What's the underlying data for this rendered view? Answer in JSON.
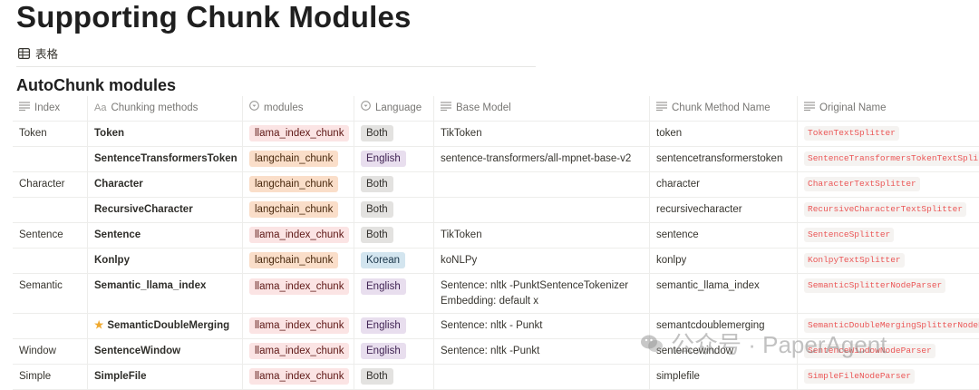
{
  "page": {
    "title": "Supporting Chunk Modules"
  },
  "view": {
    "tab_label": "表格"
  },
  "section": {
    "title": "AutoChunk modules"
  },
  "columns": [
    {
      "label": "Index",
      "icon": "text-lines-icon"
    },
    {
      "label": "Chunking methods",
      "icon": "title-aa-icon"
    },
    {
      "label": "modules",
      "icon": "select-icon"
    },
    {
      "label": "Language",
      "icon": "select-icon"
    },
    {
      "label": "Base Model",
      "icon": "text-lines-icon"
    },
    {
      "label": "Chunk Method Name",
      "icon": "text-lines-icon"
    },
    {
      "label": "Original Name",
      "icon": "text-lines-icon"
    }
  ],
  "rows": [
    {
      "index": "Token",
      "method": "Token",
      "module": "llama_index_chunk",
      "language": "Both",
      "base_model": "TikToken",
      "base_model_2": "",
      "chunk_method": "token",
      "original": "TokenTextSplitter"
    },
    {
      "index": "",
      "method": "SentenceTransformersToken",
      "module": "langchain_chunk",
      "language": "English",
      "base_model": "sentence-transformers/all-mpnet-base-v2",
      "base_model_2": "",
      "chunk_method": "sentencetransformerstoken",
      "original": "SentenceTransformersTokenTextSplitt"
    },
    {
      "index": "Character",
      "method": "Character",
      "module": "langchain_chunk",
      "language": "Both",
      "base_model": "",
      "base_model_2": "",
      "chunk_method": "character",
      "original": "CharacterTextSplitter"
    },
    {
      "index": "",
      "method": "RecursiveCharacter",
      "module": "langchain_chunk",
      "language": "Both",
      "base_model": "",
      "base_model_2": "",
      "chunk_method": "recursivecharacter",
      "original": "RecursiveCharacterTextSplitter"
    },
    {
      "index": "Sentence",
      "method": "Sentence",
      "module": "llama_index_chunk",
      "language": "Both",
      "base_model": "TikToken",
      "base_model_2": "",
      "chunk_method": "sentence",
      "original": "SentenceSplitter"
    },
    {
      "index": "",
      "method": "Konlpy",
      "module": "langchain_chunk",
      "language": "Korean",
      "base_model": "koNLPy",
      "base_model_2": "",
      "chunk_method": "konlpy",
      "original": "KonlpyTextSplitter"
    },
    {
      "index": "Semantic",
      "method": "Semantic_llama_index",
      "module": "llama_index_chunk",
      "language": "English",
      "base_model": "Sentence: nltk -PunktSentenceTokenizer",
      "base_model_2": "Embedding: default x",
      "chunk_method": "semantic_llama_index",
      "original": "SemanticSplitterNodeParser"
    },
    {
      "index": "",
      "method": "SemanticDoubleMerging",
      "module": "llama_index_chunk",
      "language": "English",
      "base_model": "Sentence: nltk - Punkt",
      "base_model_2": "",
      "chunk_method": "semantcdoublemerging",
      "original": "SemanticDoubleMergingSplitterNodePa"
    },
    {
      "index": "Window",
      "method": "SentenceWindow",
      "module": "llama_index_chunk",
      "language": "English",
      "base_model": "Sentence: nltk -Punkt",
      "base_model_2": "",
      "chunk_method": "sentencewindow",
      "original": "SentenceWindowNodeParser"
    },
    {
      "index": "Simple",
      "method": "SimpleFile",
      "module": "llama_index_chunk",
      "language": "Both",
      "base_model": "",
      "base_model_2": "",
      "chunk_method": "simplefile",
      "original": "SimpleFileNodeParser"
    }
  ],
  "watermark": {
    "text": "公众号 · PaperAgent"
  }
}
